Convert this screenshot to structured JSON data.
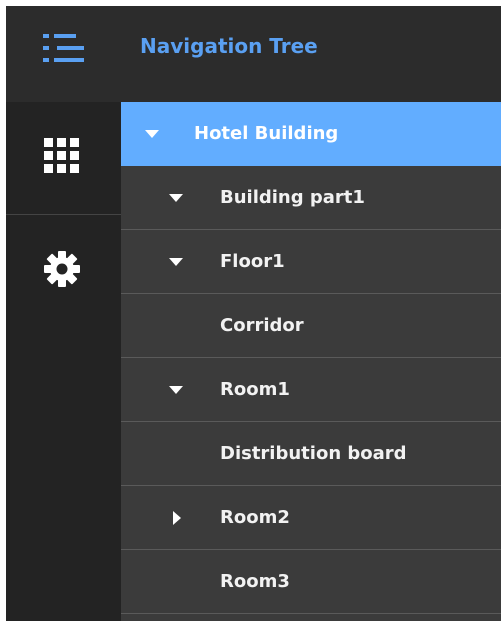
{
  "header": {
    "title": "Navigation Tree",
    "menu_icon": "list-menu-icon",
    "accent_color": "#5aa0f2"
  },
  "rail": {
    "items": [
      {
        "name": "apps",
        "icon": "grid-icon"
      },
      {
        "name": "settings",
        "icon": "gear-icon"
      }
    ]
  },
  "tree": {
    "selected_color": "#62adff",
    "nodes": [
      {
        "label": "Hotel Building",
        "level": 0,
        "state": "expanded",
        "selected": true
      },
      {
        "label": "Building part1",
        "level": 1,
        "state": "expanded",
        "selected": false
      },
      {
        "label": "Floor1",
        "level": 1,
        "state": "expanded",
        "selected": false
      },
      {
        "label": "Corridor",
        "level": 1,
        "state": "leaf",
        "selected": false
      },
      {
        "label": "Room1",
        "level": 1,
        "state": "expanded",
        "selected": false
      },
      {
        "label": "Distribution board",
        "level": 1,
        "state": "leaf",
        "selected": false
      },
      {
        "label": "Room2",
        "level": 1,
        "state": "collapsed",
        "selected": false
      },
      {
        "label": "Room3",
        "level": 1,
        "state": "leaf",
        "selected": false
      }
    ]
  }
}
